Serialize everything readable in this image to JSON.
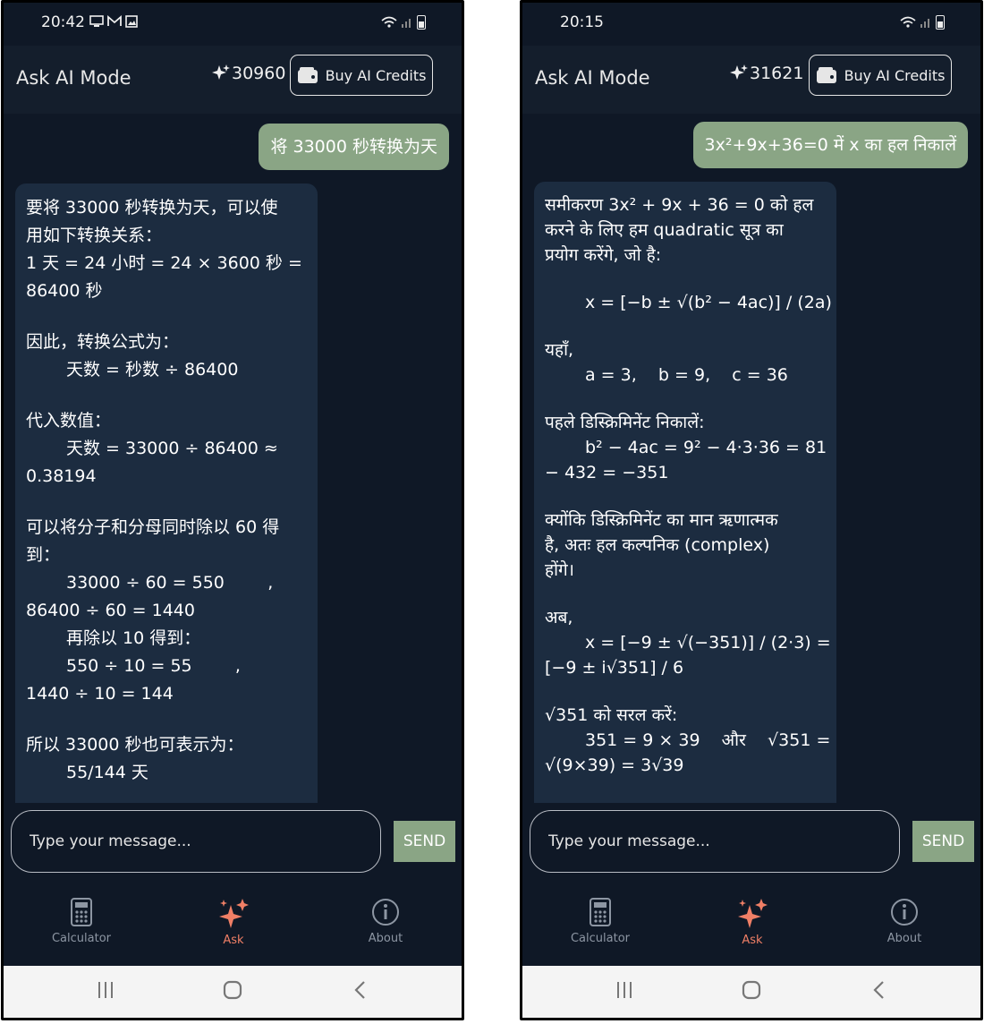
{
  "left": {
    "status": {
      "time": "20:42",
      "notification_icons": [
        "screen-icon",
        "mail-icon",
        "image-icon"
      ]
    },
    "header": {
      "title": "Ask AI Mode",
      "credits": "30960",
      "buy_label": "Buy AI Credits"
    },
    "user_message": "将 33000 秒转换为天",
    "ai_lines": [
      {
        "text": "要将 33000 秒转换为天，可以使",
        "indent": 0,
        "gap": 0
      },
      {
        "text": "用如下转换关系：",
        "indent": 0,
        "gap": 0
      },
      {
        "text": "1 天 = 24 小时 = 24 × 3600 秒 =",
        "indent": 0,
        "gap": 0
      },
      {
        "text": "86400 秒",
        "indent": 0,
        "gap": 0
      },
      {
        "text": "因此，转换公式为：",
        "indent": 0,
        "gap": 1
      },
      {
        "text": "天数 = 秒数 ÷ 86400",
        "indent": 1,
        "gap": 0
      },
      {
        "text": "代入数值：",
        "indent": 0,
        "gap": 1
      },
      {
        "text": "天数 = 33000 ÷ 86400 ≈",
        "indent": 1,
        "gap": 0
      },
      {
        "text": "0.38194",
        "indent": 0,
        "gap": 0
      },
      {
        "text": "可以将分子和分母同时除以 60 得",
        "indent": 0,
        "gap": 1
      },
      {
        "text": "到：",
        "indent": 0,
        "gap": 0
      },
      {
        "text": "33000 ÷ 60 = 550        ,",
        "indent": 1,
        "gap": 0
      },
      {
        "text": "86400 ÷ 60 = 1440",
        "indent": 0,
        "gap": 0
      },
      {
        "text": "再除以 10 得到：",
        "indent": 1,
        "gap": 0
      },
      {
        "text": "550 ÷ 10 = 55        ,",
        "indent": 1,
        "gap": 0
      },
      {
        "text": "1440 ÷ 10 = 144",
        "indent": 0,
        "gap": 0
      },
      {
        "text": "所以 33000 秒也可表示为：",
        "indent": 0,
        "gap": 1
      },
      {
        "text": "55/144 天",
        "indent": 1,
        "gap": 0
      }
    ],
    "composer": {
      "placeholder": "Type your message...",
      "send_label": "SEND"
    },
    "nav": {
      "calculator": "Calculator",
      "ask": "Ask",
      "about": "About"
    }
  },
  "right": {
    "status": {
      "time": "20:15"
    },
    "header": {
      "title": "Ask AI Mode",
      "credits": "31621",
      "buy_label": "Buy AI Credits"
    },
    "user_message": "3x²+9x+36=0 में x का हल निकालें",
    "ai_lines": [
      {
        "text": "समीकरण 3x² + 9x + 36 = 0 को हल",
        "indent": 0,
        "gap": 0
      },
      {
        "text": "करने के लिए हम quadratic सूत्र का",
        "indent": 0,
        "gap": 0
      },
      {
        "text": "प्रयोग करेंगे, जो है:",
        "indent": 0,
        "gap": 0
      },
      {
        "text": "x = [−b ± √(b² − 4ac)] / (2a)",
        "indent": 1,
        "gap": 1
      },
      {
        "text": "यहाँ,",
        "indent": 0,
        "gap": 1
      },
      {
        "text": "a = 3,    b = 9,    c = 36",
        "indent": 1,
        "gap": 0
      },
      {
        "text": "पहले डिस्क्रिमिनेंट निकालें:",
        "indent": 0,
        "gap": 1
      },
      {
        "text": "b² − 4ac = 9² − 4·3·36 = 81",
        "indent": 1,
        "gap": 0
      },
      {
        "text": "− 432 = −351",
        "indent": 0,
        "gap": 0
      },
      {
        "text": "क्योंकि डिस्क्रिमिनेंट का मान ऋणात्मक",
        "indent": 0,
        "gap": 1
      },
      {
        "text": "है, अतः हल कल्पनिक (complex)",
        "indent": 0,
        "gap": 0
      },
      {
        "text": "होंगे।",
        "indent": 0,
        "gap": 0
      },
      {
        "text": "अब,",
        "indent": 0,
        "gap": 1
      },
      {
        "text": "x = [−9 ± √(−351)] / (2·3) =",
        "indent": 1,
        "gap": 0
      },
      {
        "text": "[−9 ± i√351] / 6",
        "indent": 0,
        "gap": 0
      },
      {
        "text": "√351 को सरल करें:",
        "indent": 0,
        "gap": 1
      },
      {
        "text": "351 = 9 × 39    और    √351 =",
        "indent": 1,
        "gap": 0
      },
      {
        "text": "√(9×39) = 3√39",
        "indent": 0,
        "gap": 0
      }
    ],
    "composer": {
      "placeholder": "Type your message...",
      "send_label": "SEND"
    },
    "nav": {
      "calculator": "Calculator",
      "ask": "Ask",
      "about": "About"
    }
  },
  "colors": {
    "background": "#0f1826",
    "header": "#141e2c",
    "ai_bubble": "#1c2c40",
    "user_bubble": "#8aa585",
    "send": "#8aa585",
    "active_tab": "#f07f66"
  }
}
